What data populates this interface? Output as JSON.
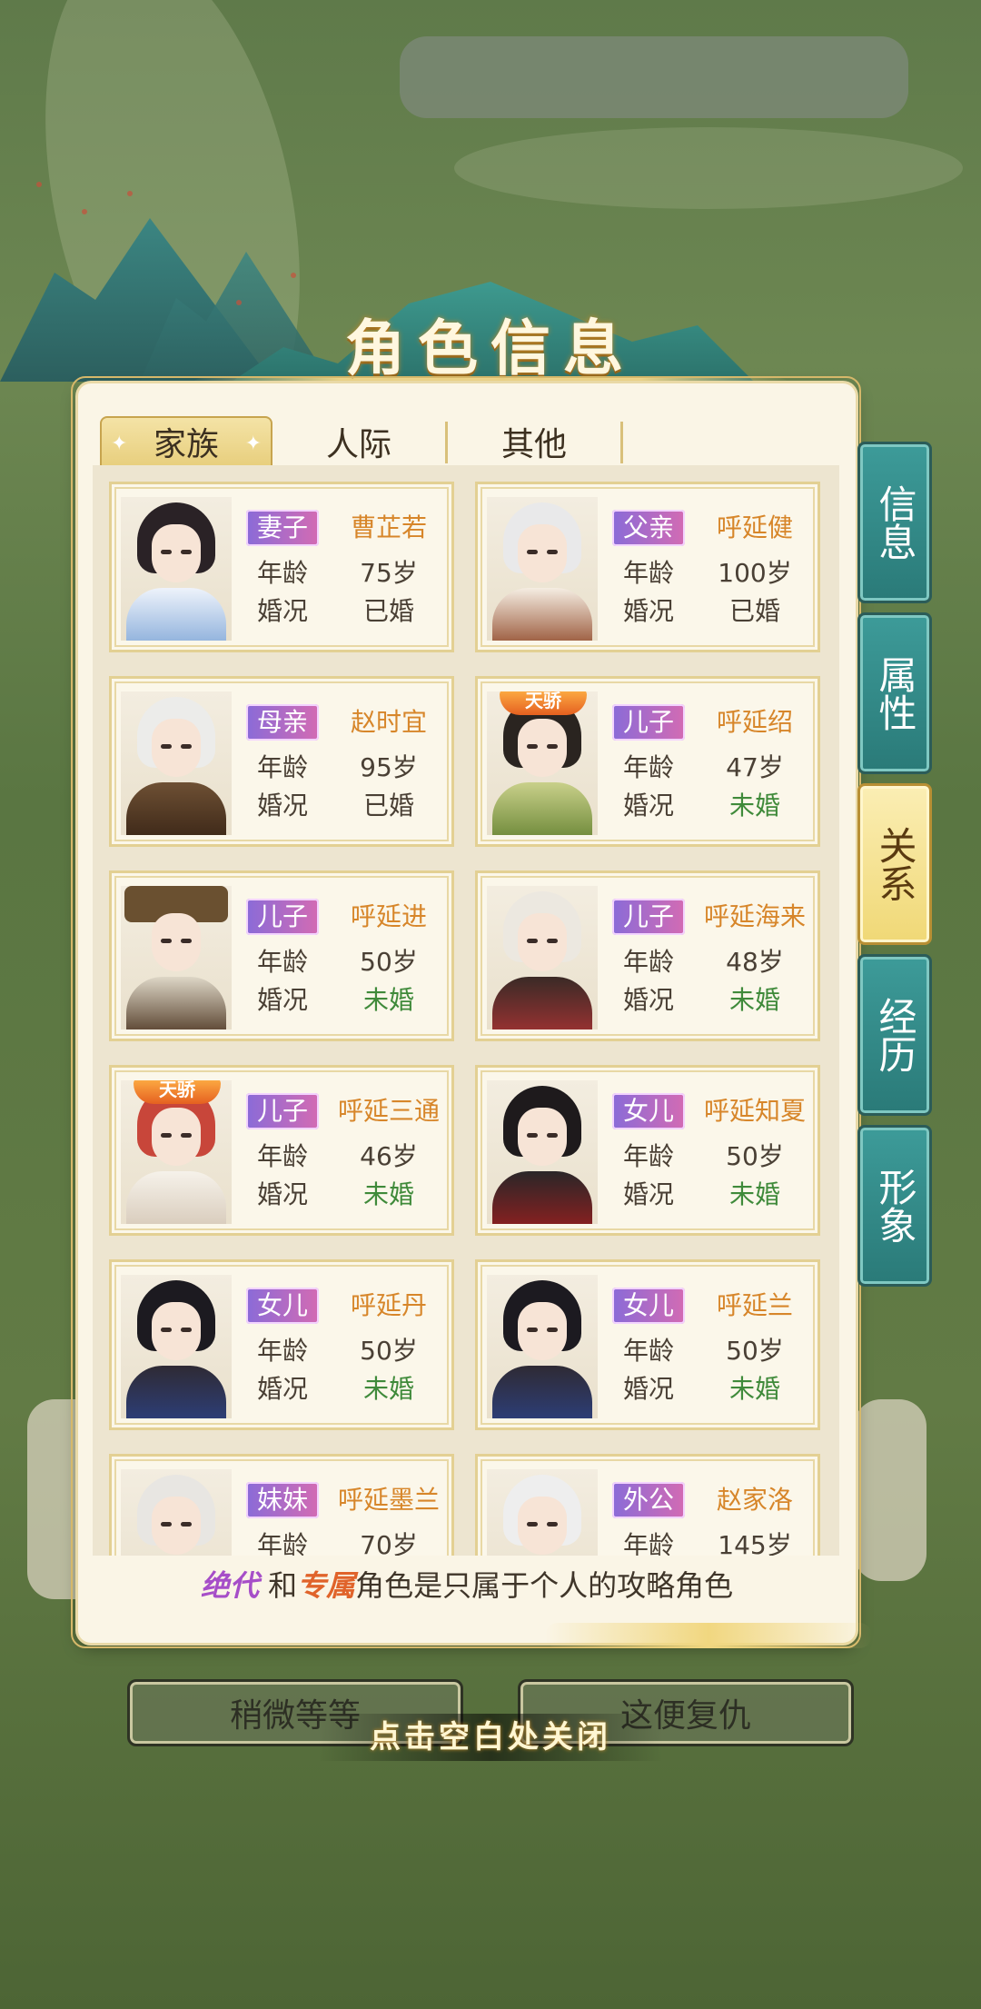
{
  "title": "角色信息",
  "tabs": [
    {
      "label": "家族",
      "active": true
    },
    {
      "label": "人际",
      "active": false
    },
    {
      "label": "其他",
      "active": false
    }
  ],
  "side_tabs": [
    {
      "label": "信息",
      "active": false
    },
    {
      "label": "属性",
      "active": false
    },
    {
      "label": "关系",
      "active": true
    },
    {
      "label": "经历",
      "active": false
    },
    {
      "label": "形象",
      "active": false
    }
  ],
  "field_labels": {
    "age": "年龄",
    "marital": "婚况"
  },
  "special_badge": "天骄",
  "members": [
    {
      "relation": "妻子",
      "name": "曹芷若",
      "age": "75岁",
      "marital": "已婚",
      "special": false
    },
    {
      "relation": "父亲",
      "name": "呼延健",
      "age": "100岁",
      "marital": "已婚",
      "special": false
    },
    {
      "relation": "母亲",
      "name": "赵时宜",
      "age": "95岁",
      "marital": "已婚",
      "special": false
    },
    {
      "relation": "儿子",
      "name": "呼延绍",
      "age": "47岁",
      "marital": "未婚",
      "special": true
    },
    {
      "relation": "儿子",
      "name": "呼延进",
      "age": "50岁",
      "marital": "未婚",
      "special": false
    },
    {
      "relation": "儿子",
      "name": "呼延海来",
      "age": "48岁",
      "marital": "未婚",
      "special": false
    },
    {
      "relation": "儿子",
      "name": "呼延三通",
      "age": "46岁",
      "marital": "未婚",
      "special": true
    },
    {
      "relation": "女儿",
      "name": "呼延知夏",
      "age": "50岁",
      "marital": "未婚",
      "special": false
    },
    {
      "relation": "女儿",
      "name": "呼延丹",
      "age": "50岁",
      "marital": "未婚",
      "special": false
    },
    {
      "relation": "女儿",
      "name": "呼延兰",
      "age": "50岁",
      "marital": "未婚",
      "special": false
    },
    {
      "relation": "妹妹",
      "name": "呼延墨兰",
      "age": "70岁",
      "marital": "",
      "special": false
    },
    {
      "relation": "外公",
      "name": "赵家洛",
      "age": "145岁",
      "marital": "",
      "special": false
    }
  ],
  "note": {
    "highlight1": "绝代",
    "connector": "和",
    "highlight2": "专属",
    "rest": "角色是只属于个人的攻略角色"
  },
  "buttons": {
    "left": "稍微等等",
    "right": "这便复仇"
  },
  "close_hint": "点击空白处关闭",
  "colors": {
    "tag_gradient_start": "#8a6bd8",
    "tag_gradient_end": "#d36bb3",
    "name": "#d7862a",
    "unmarried": "#3f8a3a",
    "side_tab": "#3d9b99"
  }
}
